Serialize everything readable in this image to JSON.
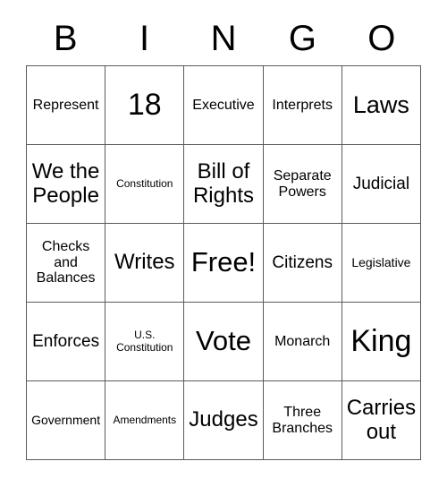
{
  "card": {
    "title": "BINGO",
    "header_letters": [
      "B",
      "I",
      "N",
      "G",
      "O"
    ],
    "free_space_label": "Free!",
    "grid": {
      "rows": 5,
      "columns": 5,
      "border_color": "#5a5a5a",
      "background_color": "#ffffff",
      "text_color": "#000000"
    },
    "cells": [
      {
        "text": "Represent",
        "size": "fs-md",
        "row": 1,
        "col": 1
      },
      {
        "text": "18",
        "size": "fs-mega",
        "row": 1,
        "col": 2
      },
      {
        "text": "Executive",
        "size": "fs-md",
        "row": 1,
        "col": 3
      },
      {
        "text": "Interprets",
        "size": "fs-md",
        "row": 1,
        "col": 4
      },
      {
        "text": "Laws",
        "size": "fs-xxl",
        "row": 1,
        "col": 5
      },
      {
        "text": "We the\nPeople",
        "size": "fs-xl",
        "row": 2,
        "col": 1
      },
      {
        "text": "Constitution",
        "size": "fs-xs",
        "row": 2,
        "col": 2
      },
      {
        "text": "Bill of\nRights",
        "size": "fs-xl",
        "row": 2,
        "col": 3
      },
      {
        "text": "Separate\nPowers",
        "size": "fs-md",
        "row": 2,
        "col": 4
      },
      {
        "text": "Judicial",
        "size": "fs-lg",
        "row": 2,
        "col": 5
      },
      {
        "text": "Checks\nand\nBalances",
        "size": "fs-md",
        "row": 3,
        "col": 1
      },
      {
        "text": "Writes",
        "size": "fs-xl",
        "row": 3,
        "col": 2
      },
      {
        "text": "Free!",
        "size": "fs-huge",
        "row": 3,
        "col": 3
      },
      {
        "text": "Citizens",
        "size": "fs-lg",
        "row": 3,
        "col": 4
      },
      {
        "text": "Legislative",
        "size": "fs-sm",
        "row": 3,
        "col": 5
      },
      {
        "text": "Enforces",
        "size": "fs-lg",
        "row": 4,
        "col": 1
      },
      {
        "text": "U.S.\nConstitution",
        "size": "fs-xs",
        "row": 4,
        "col": 2
      },
      {
        "text": "Vote",
        "size": "fs-huge",
        "row": 4,
        "col": 3
      },
      {
        "text": "Monarch",
        "size": "fs-md",
        "row": 4,
        "col": 4
      },
      {
        "text": "King",
        "size": "fs-mega",
        "row": 4,
        "col": 5
      },
      {
        "text": "Government",
        "size": "fs-sm",
        "row": 5,
        "col": 1
      },
      {
        "text": "Amendments",
        "size": "fs-xs",
        "row": 5,
        "col": 2
      },
      {
        "text": "Judges",
        "size": "fs-xl",
        "row": 5,
        "col": 3
      },
      {
        "text": "Three\nBranches",
        "size": "fs-md",
        "row": 5,
        "col": 4
      },
      {
        "text": "Carries\nout",
        "size": "fs-xl",
        "row": 5,
        "col": 5
      }
    ]
  }
}
